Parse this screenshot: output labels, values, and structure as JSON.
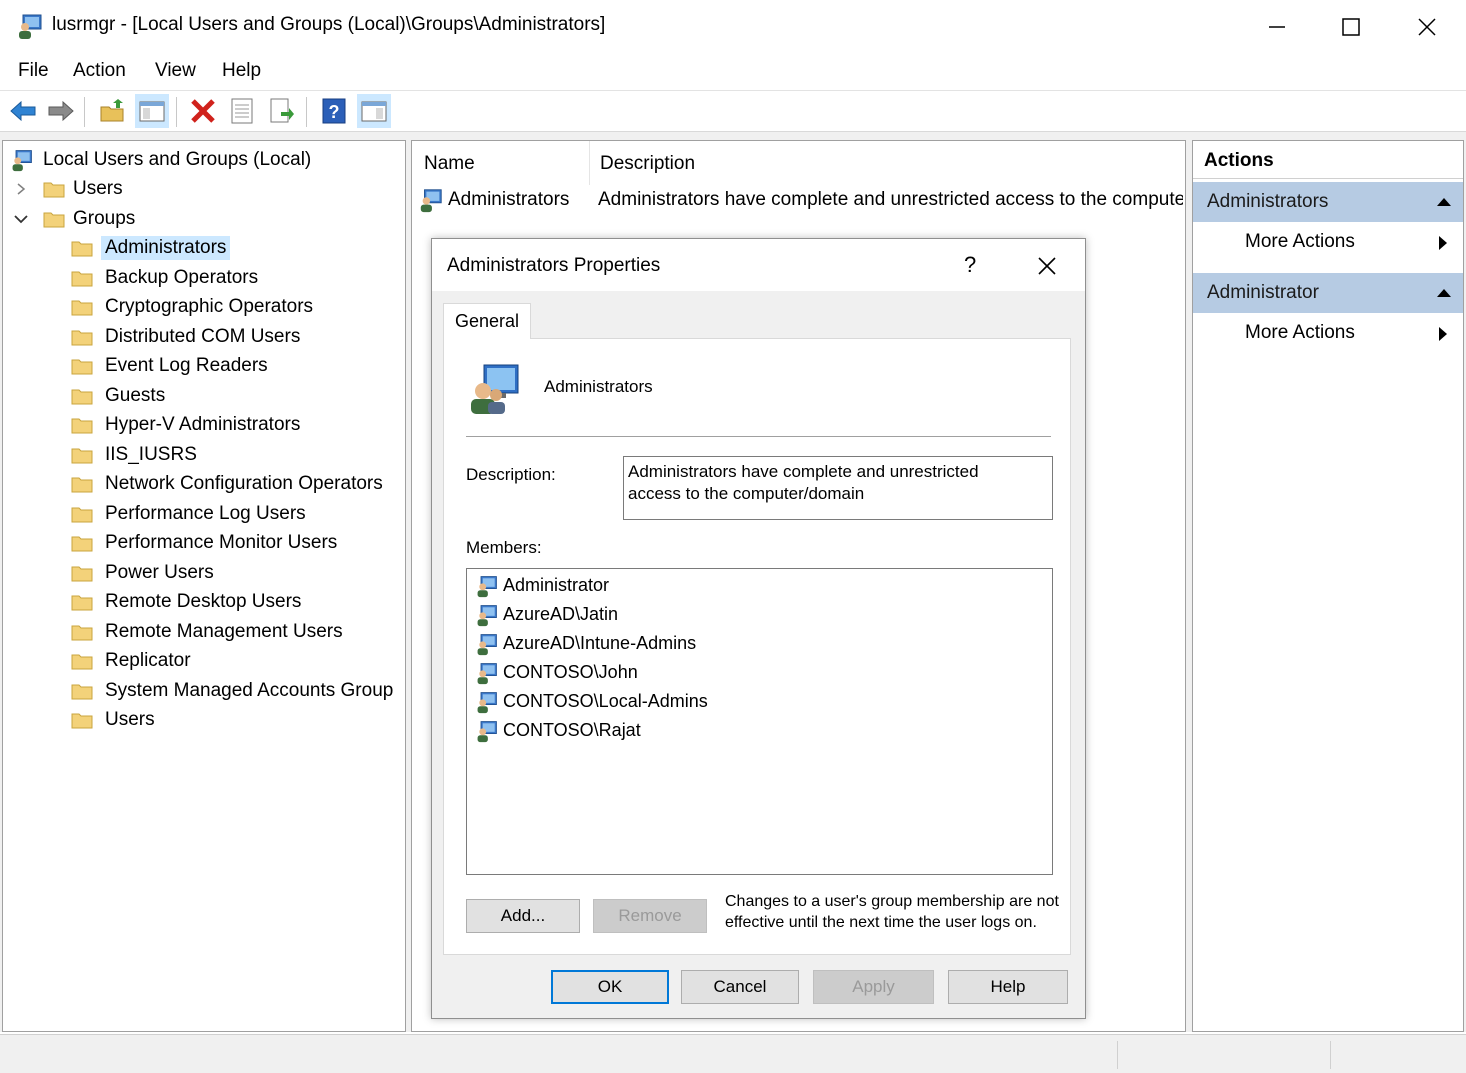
{
  "window": {
    "title": "lusrmgr - [Local Users and Groups (Local)\\Groups\\Administrators]"
  },
  "menu": [
    "File",
    "Action",
    "View",
    "Help"
  ],
  "toolbar": {
    "buttons": [
      "back-icon",
      "forward-icon",
      "up-folder-icon",
      "show-hide-tree-icon",
      "delete-icon",
      "properties-icon",
      "export-list-icon",
      "help-icon",
      "show-hide-action-pane-icon"
    ]
  },
  "tree": {
    "root": "Local Users and Groups (Local)",
    "users": "Users",
    "groups": "Groups",
    "group_items": [
      "Administrators",
      "Backup Operators",
      "Cryptographic Operators",
      "Distributed COM Users",
      "Event Log Readers",
      "Guests",
      "Hyper-V Administrators",
      "IIS_IUSRS",
      "Network Configuration Operators",
      "Performance Log Users",
      "Performance Monitor Users",
      "Power Users",
      "Remote Desktop Users",
      "Remote Management Users",
      "Replicator",
      "System Managed Accounts Group",
      "Users"
    ],
    "selected": "Administrators"
  },
  "list": {
    "columns": [
      "Name",
      "Description"
    ],
    "rows": [
      {
        "name": "Administrators",
        "description": "Administrators have complete and unrestricted access to the computer/domain"
      }
    ]
  },
  "actions": {
    "title": "Actions",
    "groups": [
      {
        "label": "Administrators",
        "item": "More Actions"
      },
      {
        "label": "Administrator",
        "item": "More Actions"
      }
    ]
  },
  "dialog": {
    "title": "Administrators Properties",
    "help_glyph": "?",
    "tab": "General",
    "group_name": "Administrators",
    "description_label": "Description:",
    "description_line1": "Administrators have complete and unrestricted",
    "description_line2": "access to the computer/domain",
    "members_label": "Members:",
    "members": [
      "Administrator",
      "AzureAD\\Jatin",
      "AzureAD\\Intune-Admins",
      "CONTOSO\\John",
      "CONTOSO\\Local-Admins",
      "CONTOSO\\Rajat"
    ],
    "add_label": "Add...",
    "remove_label": "Remove",
    "note_line1": "Changes to a user's group membership are not",
    "note_line2": "effective until the next time the user logs on.",
    "ok_label": "OK",
    "cancel_label": "Cancel",
    "apply_label": "Apply",
    "help_label": "Help"
  },
  "colors": {
    "selection": "#cce8ff",
    "action_group": "#b6cbe3",
    "ok_border": "#0078d7"
  }
}
